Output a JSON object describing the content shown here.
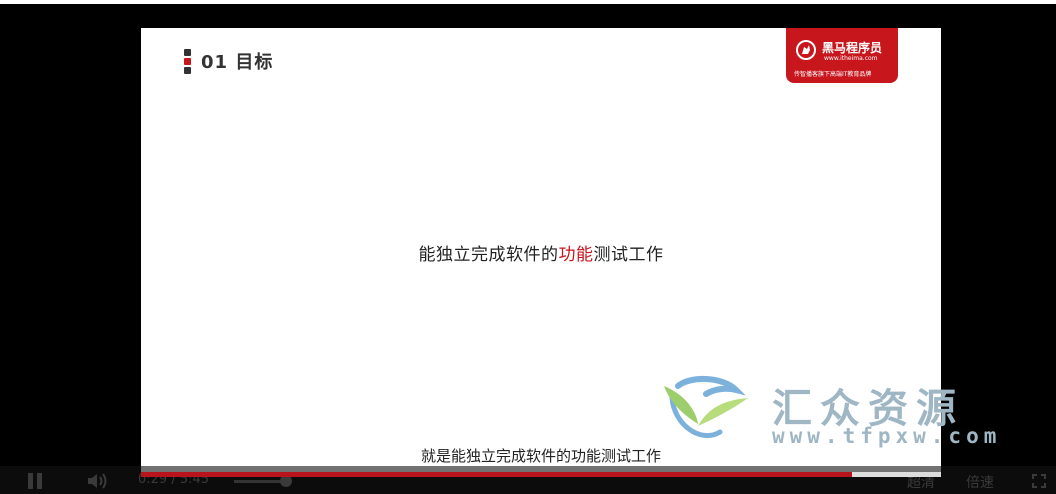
{
  "slide": {
    "section_number": "01",
    "section_title": "目标",
    "marker_colors": [
      "#333333",
      "#c8161d",
      "#333333"
    ],
    "brand": {
      "name": "黑马程序员",
      "url": "www.itheima.com",
      "slogan": "传智播客旗下高端IT教育品牌",
      "color": "#c8161d"
    },
    "main_text_before": "能独立完成软件的",
    "main_text_highlight": "功能",
    "main_text_after": "测试工作",
    "highlight_color": "#c8161d"
  },
  "subtitle": "就是能独立完成软件的功能测试工作",
  "watermark": {
    "title": "汇众资源",
    "url": "www.tfpxw.com"
  },
  "player": {
    "progress": 0.889,
    "current_time": "0:29",
    "separator": "/",
    "duration": "5:45",
    "time_text": "0:29 / 5:45",
    "quality_label": "超清",
    "speed_label": "倍速",
    "volume_level": 0.8,
    "icons": [
      "pause-icon",
      "volume-icon",
      "fullscreen-icon"
    ]
  }
}
